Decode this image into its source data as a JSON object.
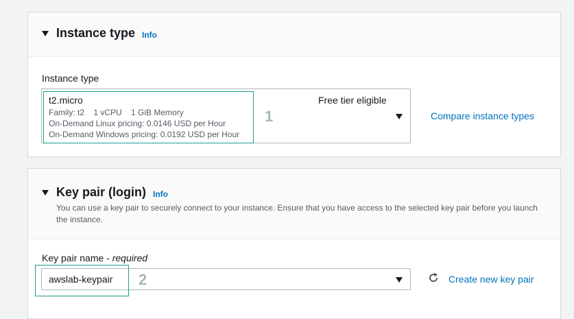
{
  "instance_type_section": {
    "title": "Instance type",
    "info_label": "Info",
    "field_label": "Instance type",
    "selected": {
      "name": "t2.micro",
      "tag": "Free tier eligible",
      "family_line": "Family: t2    1 vCPU    1 GiB Memory",
      "linux_pricing": "On-Demand Linux pricing: 0.0146 USD per Hour",
      "windows_pricing": "On-Demand Windows pricing: 0.0192 USD per Hour"
    },
    "step_marker": "1",
    "compare_link": "Compare instance types"
  },
  "key_pair_section": {
    "title": "Key pair (login)",
    "info_label": "Info",
    "description": "You can use a key pair to securely connect to your instance. Ensure that you have access to the selected key pair before you launch the instance.",
    "field_label": "Key pair name - ",
    "field_label_required": "required",
    "selected_value": "awslab-keypair",
    "step_marker": "2",
    "create_link": "Create new key pair"
  },
  "icons": {
    "collapse": "caret-down-icon",
    "dropdown": "caret-down-icon",
    "refresh": "refresh-icon"
  },
  "colors": {
    "link": "#0073bb",
    "highlight_outline": "#1a9c8c",
    "step_marker": "#aab7b8"
  }
}
